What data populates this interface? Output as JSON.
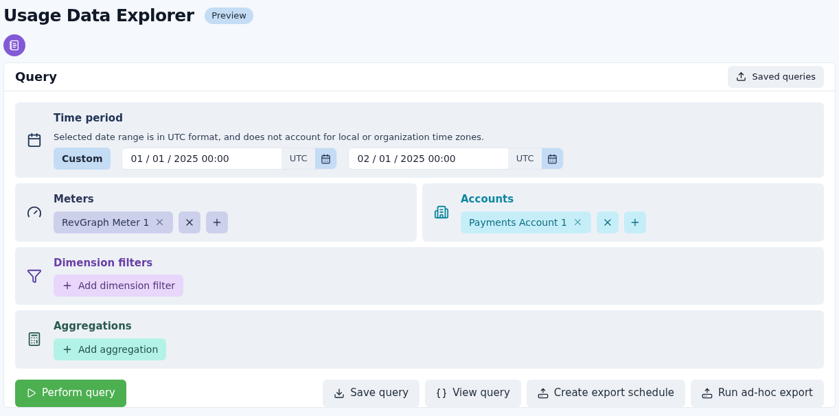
{
  "header": {
    "title": "Usage Data Explorer",
    "badge": "Preview"
  },
  "card": {
    "title": "Query",
    "saved_queries": "Saved queries"
  },
  "time_period": {
    "title": "Time period",
    "note": "Selected date range is in UTC format, and does not account for local or organization time zones.",
    "preset": "Custom",
    "start": {
      "value": "01 / 01 / 2025 00:00",
      "zone": "UTC"
    },
    "end": {
      "value": "02 / 01 / 2025 00:00",
      "zone": "UTC"
    }
  },
  "meters": {
    "title": "Meters",
    "chips": [
      "RevGraph Meter 1"
    ]
  },
  "accounts": {
    "title": "Accounts",
    "chips": [
      "Payments Account 1"
    ]
  },
  "dimension_filters": {
    "title": "Dimension filters",
    "add": "Add dimension filter"
  },
  "aggregations": {
    "title": "Aggregations",
    "add": "Add aggregation"
  },
  "footer": {
    "perform": "Perform query",
    "actions": [
      {
        "kind": "save",
        "label": "Save query"
      },
      {
        "kind": "view",
        "label": "View query"
      },
      {
        "kind": "schedule",
        "label": "Create export schedule"
      },
      {
        "kind": "export",
        "label": "Run ad-hoc export"
      }
    ]
  }
}
